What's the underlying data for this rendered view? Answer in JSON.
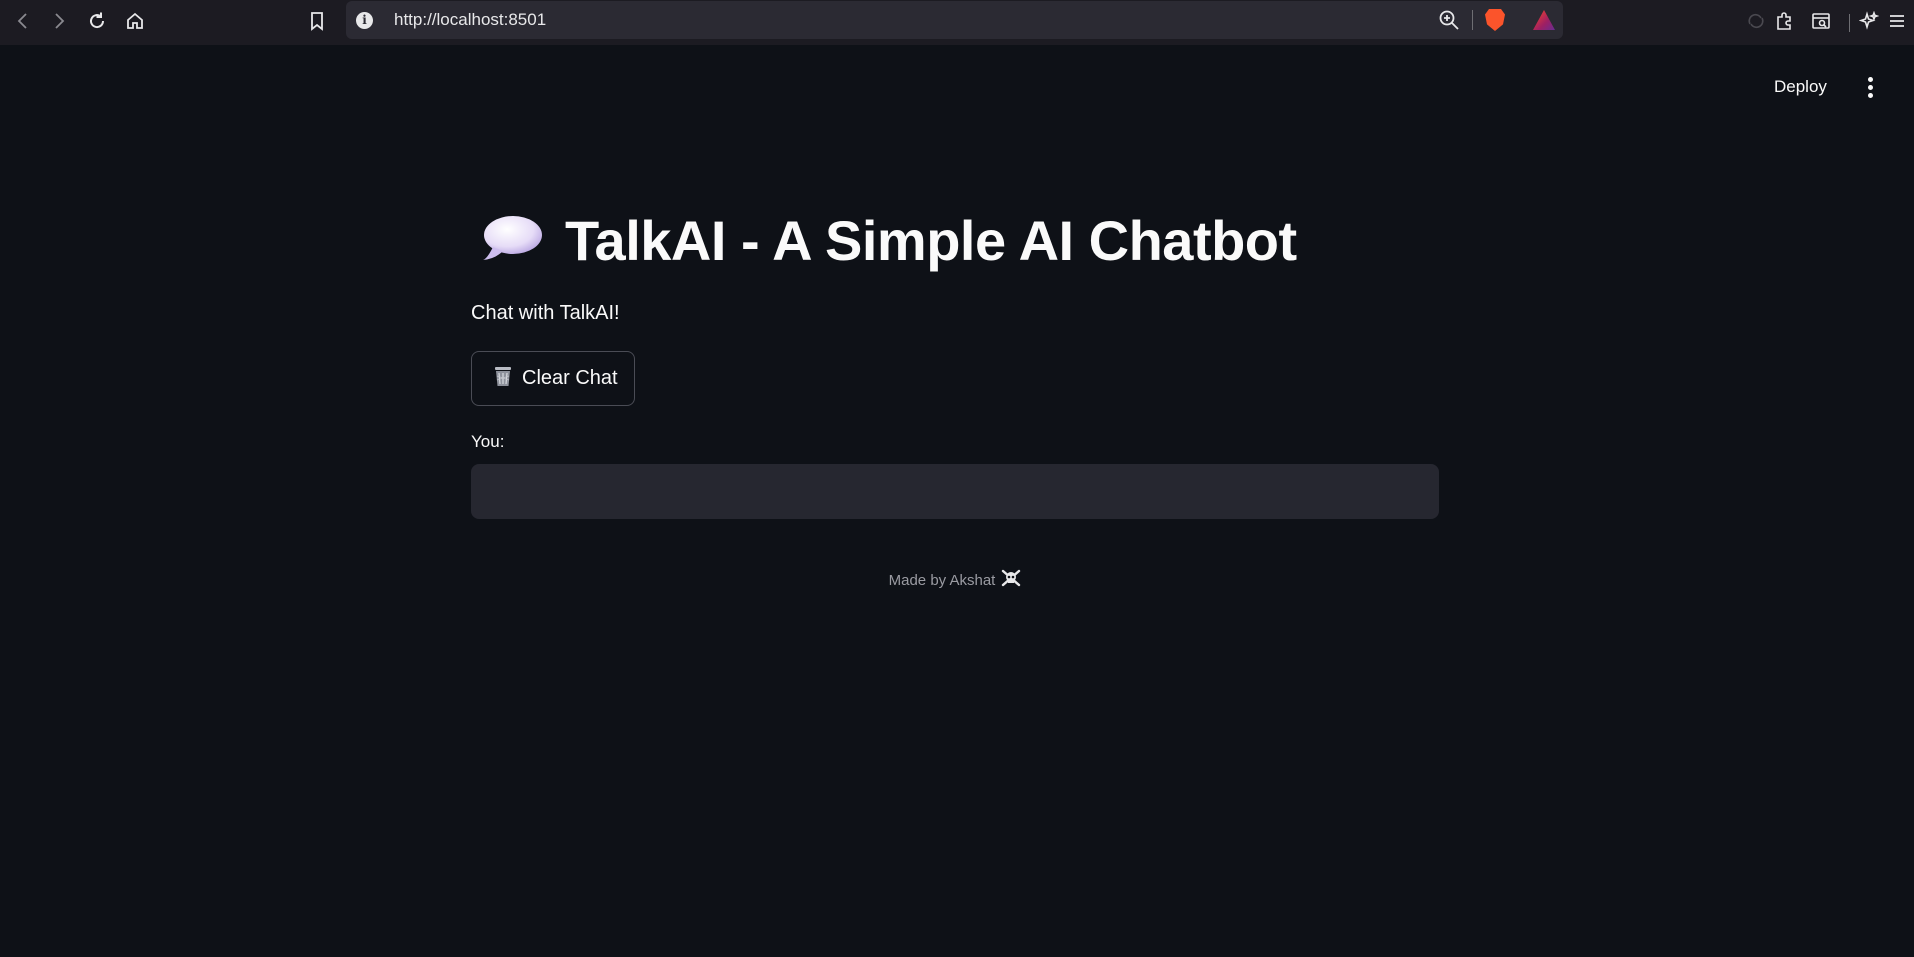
{
  "browser": {
    "url": "http://localhost:8501",
    "nav_icons": [
      "back-icon",
      "forward-icon",
      "reload-icon",
      "home-icon",
      "bookmark-icon"
    ],
    "toolbar_icons": [
      "zoom-icon",
      "brave-shields-icon",
      "brave-rewards-icon",
      "extensions-icon",
      "sidebar-icon",
      "leo-ai-icon",
      "menu-icon"
    ]
  },
  "header": {
    "deploy_label": "Deploy"
  },
  "main": {
    "title_icon": "speech-bubble-icon",
    "title": "TalkAI - A Simple AI Chatbot",
    "subtitle": "Chat with TalkAI!",
    "clear_button": {
      "icon": "trash-icon",
      "label": "Clear Chat"
    },
    "input": {
      "label": "You:",
      "value": "",
      "placeholder": ""
    }
  },
  "footer": {
    "text": "Made by Akshat",
    "icon": "skull-crossbones-icon"
  },
  "colors": {
    "background": "#0e1117",
    "input_bg": "#262730",
    "text": "#fafafa",
    "muted_text": "#9a9ba2",
    "browser_bar": "#1c1b22",
    "url_bar": "#2b2a33"
  }
}
